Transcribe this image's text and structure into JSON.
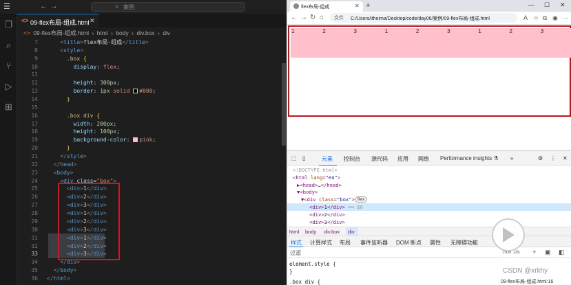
{
  "vscode": {
    "menu_icon": "☰",
    "search_placeholder": "案例",
    "tab": {
      "title": "09-flex布局-组成.html",
      "icon": "<>"
    },
    "breadcrumb": [
      "09-flex布局-组成.html",
      "html",
      "body",
      "div.box",
      "div"
    ],
    "current_line": "33",
    "lines": [
      {
        "n": "7",
        "indent": "    ",
        "html": "<span class='p'>&lt;</span><span class='t'>title</span><span class='p'>&gt;</span>flex布局-组成<span class='p'>&lt;/</span><span class='t'>title</span><span class='p'>&gt;</span>"
      },
      {
        "n": "8",
        "indent": "    ",
        "html": "<span class='p'>&lt;</span><span class='t'>style</span><span class='p'>&gt;</span>"
      },
      {
        "n": "9",
        "indent": "      ",
        "html": "<span class='sel'>.box</span> <span class='br'>{</span>"
      },
      {
        "n": "10",
        "indent": "        ",
        "html": "<span class='prop'>display</span>: <span class='kw'>flex</span>;"
      },
      {
        "n": "11",
        "indent": "",
        "html": ""
      },
      {
        "n": "12",
        "indent": "        ",
        "html": "<span class='prop'>height</span>: <span class='num'>300px</span>;"
      },
      {
        "n": "13",
        "indent": "        ",
        "html": "<span class='prop'>border</span>: <span class='num'>1px</span> <span class='kw'>solid</span> <span class='swatch' style='background:#000'></span><span class='kw'>#000</span>;"
      },
      {
        "n": "14",
        "indent": "      ",
        "html": "<span class='br'>}</span>"
      },
      {
        "n": "15",
        "indent": "",
        "html": ""
      },
      {
        "n": "16",
        "indent": "      ",
        "html": "<span class='sel'>.box div</span> <span class='br'>{</span>"
      },
      {
        "n": "17",
        "indent": "        ",
        "html": "<span class='prop'>width</span>: <span class='num'>200px</span>;"
      },
      {
        "n": "18",
        "indent": "        ",
        "html": "<span class='prop'>height</span>: <span class='num'>100px</span>;"
      },
      {
        "n": "19",
        "indent": "        ",
        "html": "<span class='prop'>background-color</span>: <span class='swatch' style='background:pink'></span><span class='kw'>pink</span>;"
      },
      {
        "n": "20",
        "indent": "      ",
        "html": "<span class='br'>}</span>"
      },
      {
        "n": "21",
        "indent": "    ",
        "html": "<span class='p'>&lt;/</span><span class='t'>style</span><span class='p'>&gt;</span>"
      },
      {
        "n": "22",
        "indent": "  ",
        "html": "<span class='p'>&lt;/</span><span class='t'>head</span><span class='p'>&gt;</span>"
      },
      {
        "n": "23",
        "indent": "  ",
        "html": "<span class='p'>&lt;</span><span class='t'>body</span><span class='p'>&gt;</span>"
      },
      {
        "n": "24",
        "indent": "    ",
        "html": "<span class='p'>&lt;</span><span class='t'>div</span> <span class='a'>class</span>=<span class='s'>\"box\"</span><span class='p'>&gt;</span>"
      },
      {
        "n": "25",
        "indent": "      ",
        "html": "<span class='p'>&lt;</span><span class='t'>div</span><span class='p'>&gt;</span>1<span class='p'>&lt;/</span><span class='t'>div</span><span class='p'>&gt;</span>"
      },
      {
        "n": "26",
        "indent": "      ",
        "html": "<span class='p'>&lt;</span><span class='t'>div</span><span class='p'>&gt;</span>2<span class='p'>&lt;/</span><span class='t'>div</span><span class='p'>&gt;</span>"
      },
      {
        "n": "27",
        "indent": "      ",
        "html": "<span class='p'>&lt;</span><span class='t'>div</span><span class='p'>&gt;</span>3<span class='p'>&lt;/</span><span class='t'>div</span><span class='p'>&gt;</span>"
      },
      {
        "n": "28",
        "indent": "      ",
        "html": "<span class='p'>&lt;</span><span class='t'>div</span><span class='p'>&gt;</span>1<span class='p'>&lt;/</span><span class='t'>div</span><span class='p'>&gt;</span>"
      },
      {
        "n": "29",
        "indent": "      ",
        "html": "<span class='p'>&lt;</span><span class='t'>div</span><span class='p'>&gt;</span>2<span class='p'>&lt;/</span><span class='t'>div</span><span class='p'>&gt;</span>"
      },
      {
        "n": "30",
        "indent": "      ",
        "html": "<span class='p'>&lt;</span><span class='t'>div</span><span class='p'>&gt;</span>3<span class='p'>&lt;/</span><span class='t'>div</span><span class='p'>&gt;</span>"
      },
      {
        "n": "31",
        "indent": "      ",
        "html": "<span class='p'>&lt;</span><span class='t'>div</span><span class='p'>&gt;</span>1<span class='p'>&lt;/</span><span class='t'>div</span><span class='p'>&gt;</span>"
      },
      {
        "n": "32",
        "indent": "      ",
        "html": "<span class='p'>&lt;</span><span class='t'>div</span><span class='p'>&gt;</span>2<span class='p'>&lt;/</span><span class='t'>div</span><span class='p'>&gt;</span>"
      },
      {
        "n": "33",
        "indent": "      ",
        "html": "<span class='p'>&lt;</span><span class='t'>div</span><span class='p'>&gt;</span>3<span class='p'>&lt;/</span><span class='t'>div</span><span class='p'>&gt;</span>"
      },
      {
        "n": "34",
        "indent": "    ",
        "html": "<span class='p'>&lt;/</span><span class='t'>div</span><span class='p'>&gt;</span>"
      },
      {
        "n": "35",
        "indent": "  ",
        "html": "<span class='p'>&lt;/</span><span class='t'>body</span><span class='p'>&gt;</span>"
      },
      {
        "n": "36",
        "indent": "",
        "html": "<span class='p'>&lt;/</span><span class='t'>html</span><span class='p'>&gt;</span>"
      }
    ]
  },
  "browser": {
    "tab_title": "flex布局-组成",
    "new_tab": "+",
    "url_prefix": "文件",
    "url": "C:/Users/itheima/Desktop/code/day06/案例/09-flex布局-组成.html",
    "page_items": [
      "1",
      "2",
      "3",
      "1",
      "2",
      "3",
      "1",
      "2",
      "3"
    ],
    "devtools": {
      "tabs": [
        "元素",
        "控制台",
        "源代码",
        "应用",
        "网络",
        "Performance insights ⚗"
      ],
      "more": "»",
      "dom_lines": [
        {
          "indent": 1,
          "html": "<span class='cm'>&lt;!DOCTYPE html&gt;</span>"
        },
        {
          "indent": 1,
          "html": "&lt;html <span class='at'>lang</span>=<span class='av'>\"en\"</span>&gt;"
        },
        {
          "indent": 2,
          "html": "▶&lt;head&gt;<span class='tx'>…</span>&lt;/head&gt;"
        },
        {
          "indent": 2,
          "html": "▼&lt;body&gt;"
        },
        {
          "indent": 3,
          "html": "▼&lt;div <span class='at'>class</span>=<span class='av'>\"box\"</span>&gt;"
        },
        {
          "indent": 5,
          "html": "&lt;div&gt;<span class='tx'>1</span>&lt;/div&gt; <span class='cm'>== $0</span>"
        },
        {
          "indent": 5,
          "html": "&lt;div&gt;<span class='tx'>2</span>&lt;/div&gt;"
        },
        {
          "indent": 5,
          "html": "&lt;div&gt;<span class='tx'>3</span>&lt;/div&gt;"
        }
      ],
      "flex_badge": "flex",
      "crumbs": [
        "html",
        "body",
        "div.box",
        "div"
      ],
      "subtabs": [
        "样式",
        "计算样式",
        "布局",
        "事件监听器",
        "DOM 断点",
        "属性",
        "无障碍功能"
      ],
      "filter_placeholder": "过滤",
      "filter_right": ":hov .cls",
      "style_lines": [
        "element.style {",
        "}",
        ".box div {"
      ],
      "status_file": "09-flex布局-组成.html:16"
    }
  },
  "watermark": "CSDN @xrkhy"
}
